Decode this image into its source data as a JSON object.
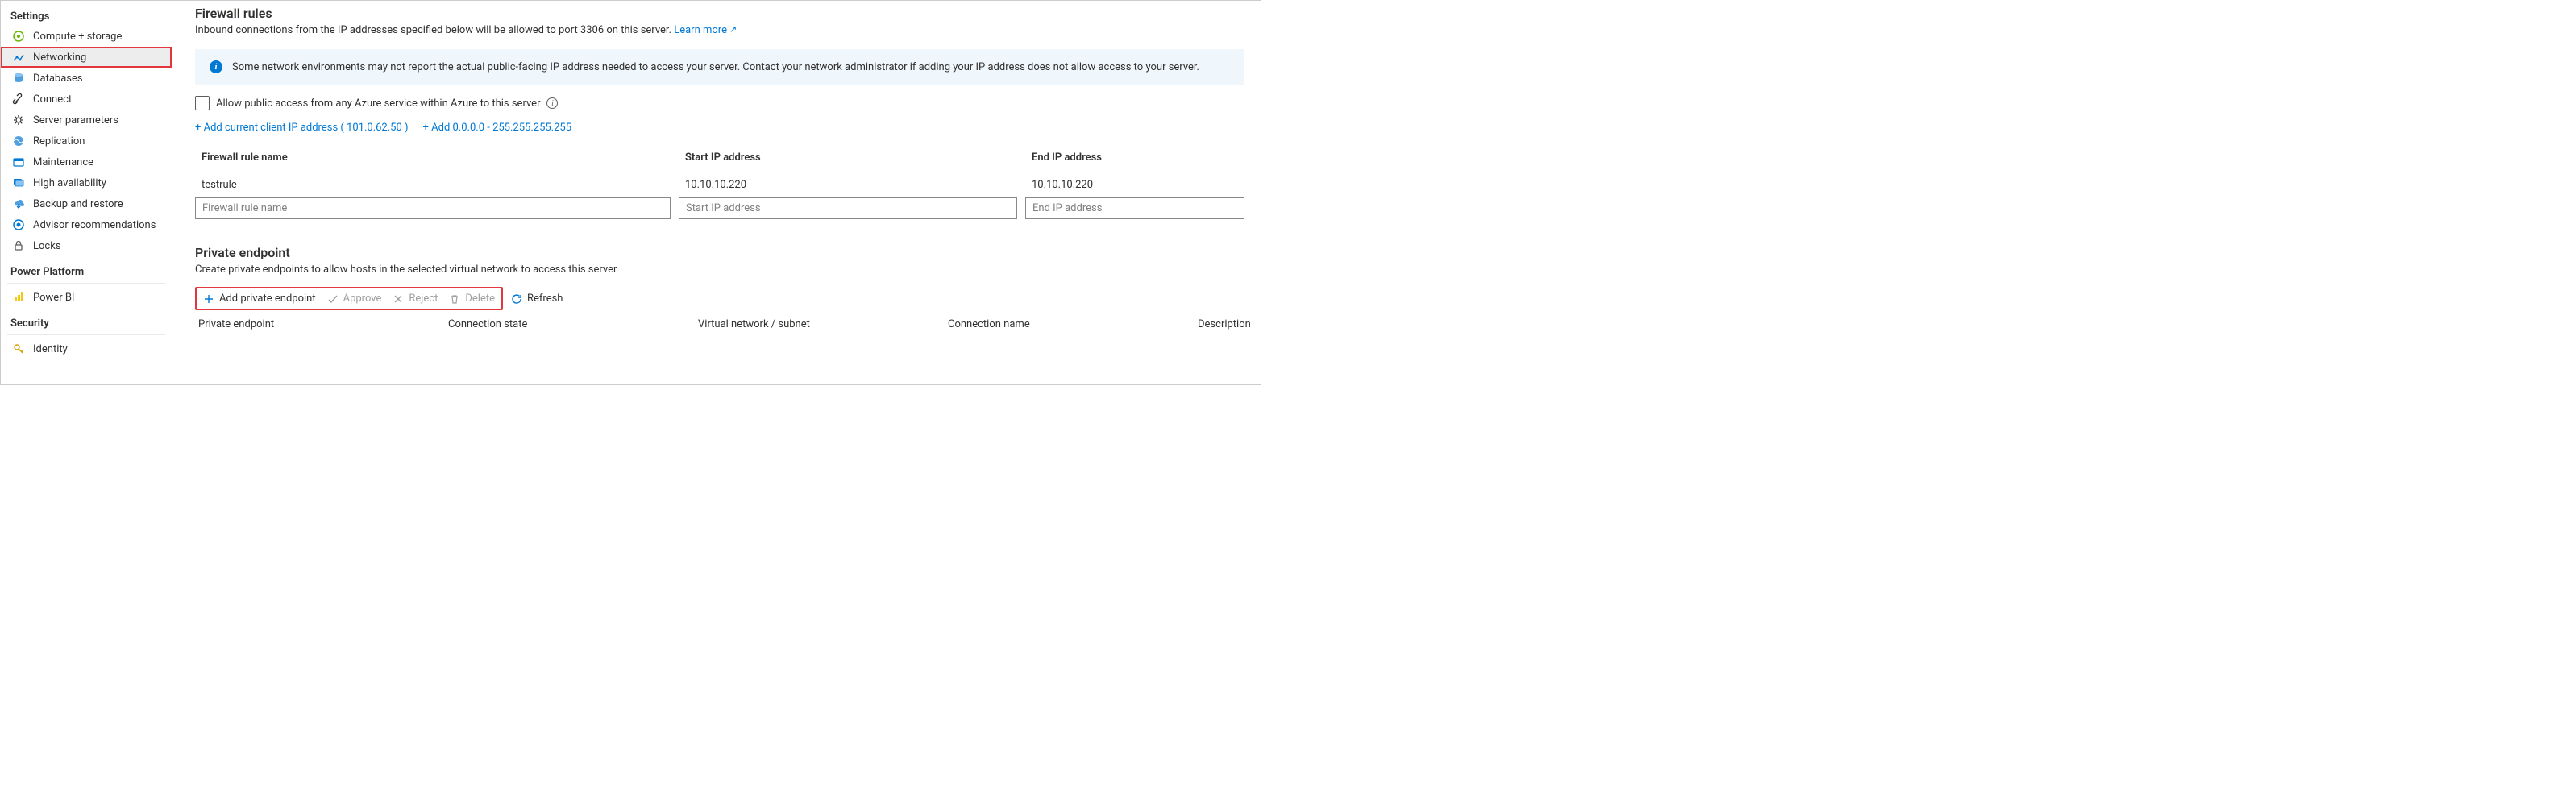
{
  "sidebar": {
    "sections": {
      "settings": "Settings",
      "power_platform": "Power Platform",
      "security": "Security"
    },
    "items": {
      "compute": "Compute + storage",
      "networking": "Networking",
      "databases": "Databases",
      "connect": "Connect",
      "server_params": "Server parameters",
      "replication": "Replication",
      "maintenance": "Maintenance",
      "high_availability": "High availability",
      "backup_restore": "Backup and restore",
      "advisor": "Advisor recommendations",
      "locks": "Locks",
      "powerbi": "Power BI",
      "identity": "Identity"
    }
  },
  "firewall": {
    "title": "Firewall rules",
    "description_prefix": "Inbound connections from the IP addresses specified below will be allowed to port 3306 on this server. ",
    "learn_more": "Learn more",
    "info_banner": "Some network environments may not report the actual public-facing IP address needed to access your server.  Contact your network administrator if adding your IP address does not allow access to your server.",
    "allow_public_label": "Allow public access from any Azure service within Azure to this server",
    "add_client_ip": "+ Add current client IP address ( 101.0.62.50 )",
    "add_range": "+ Add 0.0.0.0 - 255.255.255.255",
    "headers": {
      "name": "Firewall rule name",
      "start": "Start IP address",
      "end": "End IP address"
    },
    "row": {
      "name": "testrule",
      "start": "10.10.10.220",
      "end": "10.10.10.220"
    },
    "placeholders": {
      "name": "Firewall rule name",
      "start": "Start IP address",
      "end": "End IP address"
    }
  },
  "private_endpoint": {
    "title": "Private endpoint",
    "description": "Create private endpoints to allow hosts in the selected virtual network to access this server",
    "toolbar": {
      "add": "Add private endpoint",
      "approve": "Approve",
      "reject": "Reject",
      "delete": "Delete",
      "refresh": "Refresh"
    },
    "headers": {
      "pe": "Private endpoint",
      "conn_state": "Connection state",
      "vnet": "Virtual network / subnet",
      "conn_name": "Connection name",
      "desc": "Description"
    }
  }
}
